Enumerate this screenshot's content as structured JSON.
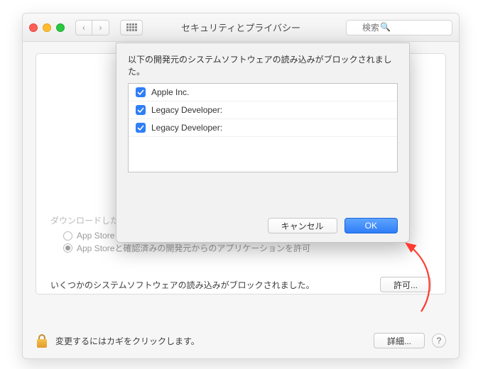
{
  "window": {
    "title": "セキュリティとプライバシー",
    "search_placeholder": "検索"
  },
  "panel": {
    "exec_label_partial": "ダウンロードしたアプリケーションの実行許可：",
    "radio": {
      "appstore": "App Store",
      "identified": "App Storeと確認済みの開発元からのアプリケーションを許可"
    },
    "blocked_text": "いくつかのシステムソフトウェアの読み込みがブロックされました。",
    "allow_btn": "許可..."
  },
  "footer": {
    "lock_text": "変更するにはカギをクリックします。",
    "details_btn": "詳細..."
  },
  "sheet": {
    "message": "以下の開発元のシステムソフトウェアの読み込みがブロックされました。",
    "items": [
      {
        "label": "Apple Inc.",
        "checked": true
      },
      {
        "label": "Legacy Developer:",
        "checked": true
      },
      {
        "label": "Legacy Developer:",
        "checked": true
      }
    ],
    "cancel": "キャンセル",
    "ok": "OK"
  }
}
